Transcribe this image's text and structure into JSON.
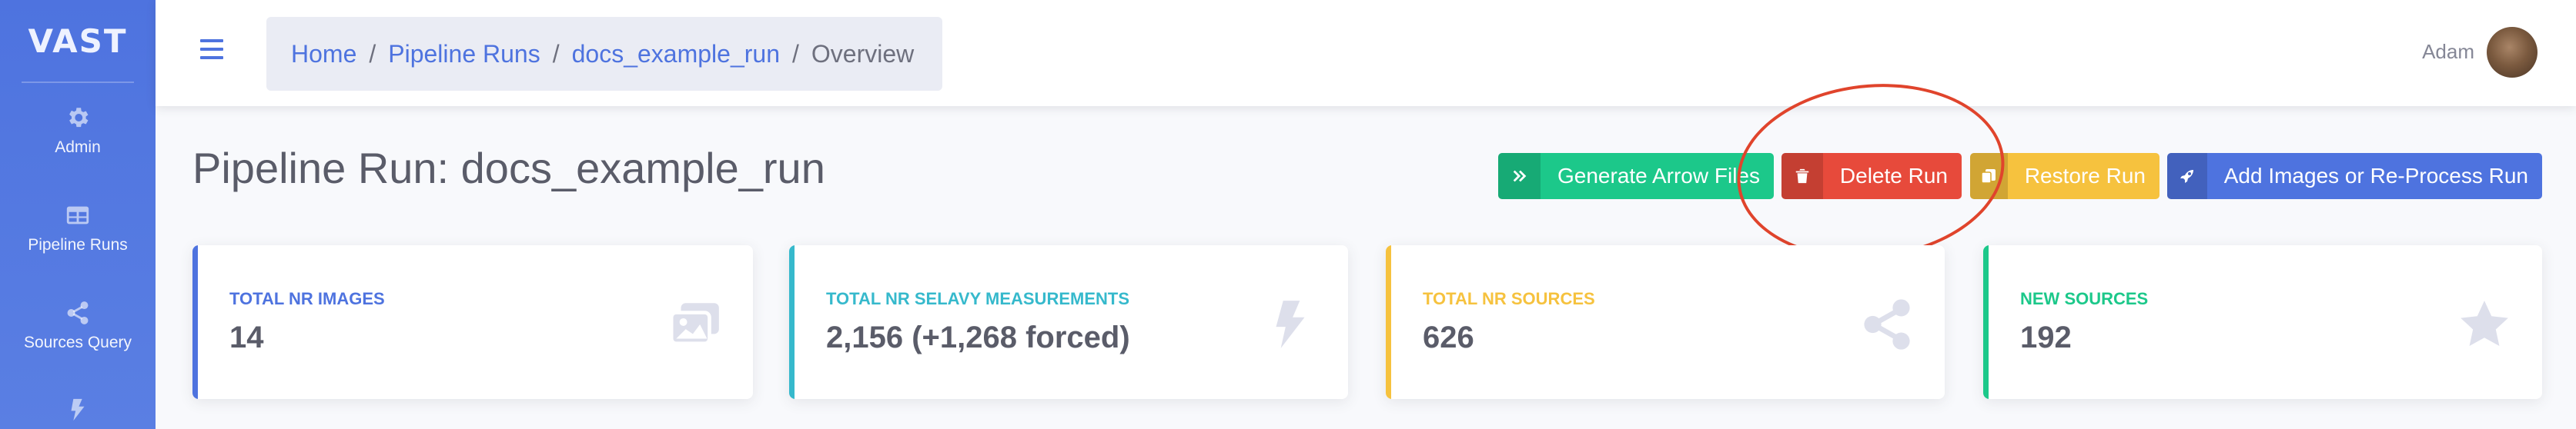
{
  "sidebar": {
    "brand": "VAST",
    "items": [
      {
        "label": "Admin",
        "icon": "gear-icon"
      },
      {
        "label": "Pipeline Runs",
        "icon": "table-icon"
      },
      {
        "label": "Sources Query",
        "icon": "share-icon"
      },
      {
        "label": "",
        "icon": "bolt-icon"
      }
    ]
  },
  "topbar": {
    "breadcrumb": [
      {
        "label": "Home"
      },
      {
        "label": "Pipeline Runs"
      },
      {
        "label": "docs_example_run"
      },
      {
        "label": "Overview"
      }
    ],
    "separator": "/",
    "user_name": "Adam"
  },
  "page": {
    "title": "Pipeline Run: docs_example_run"
  },
  "actions": {
    "generate": {
      "label": "Generate Arrow Files",
      "icon": "double-chevron-right-icon",
      "color": "#1cc88a"
    },
    "delete": {
      "label": "Delete Run",
      "icon": "trash-icon",
      "color": "#e74a3b"
    },
    "restore": {
      "label": "Restore Run",
      "icon": "copy-icon",
      "color": "#f6c23e"
    },
    "add": {
      "label": "Add Images or Re-Process Run",
      "icon": "rocket-icon",
      "color": "#4e73df"
    }
  },
  "cards": [
    {
      "title": "TOTAL NR IMAGES",
      "value": "14",
      "icon": "images-icon",
      "color": "#4e73df"
    },
    {
      "title": "TOTAL NR SELAVY MEASUREMENTS",
      "value": "2,156 (+1,268 forced)",
      "icon": "bolt-icon",
      "color": "#36b9cc"
    },
    {
      "title": "TOTAL NR SOURCES",
      "value": "626",
      "icon": "share-icon",
      "color": "#f6c23e"
    },
    {
      "title": "NEW SOURCES",
      "value": "192",
      "icon": "star-icon",
      "color": "#1cc88a"
    }
  ],
  "annotation": {
    "shape": "ellipse",
    "target": "delete-run-button",
    "color": "#e0442c"
  }
}
